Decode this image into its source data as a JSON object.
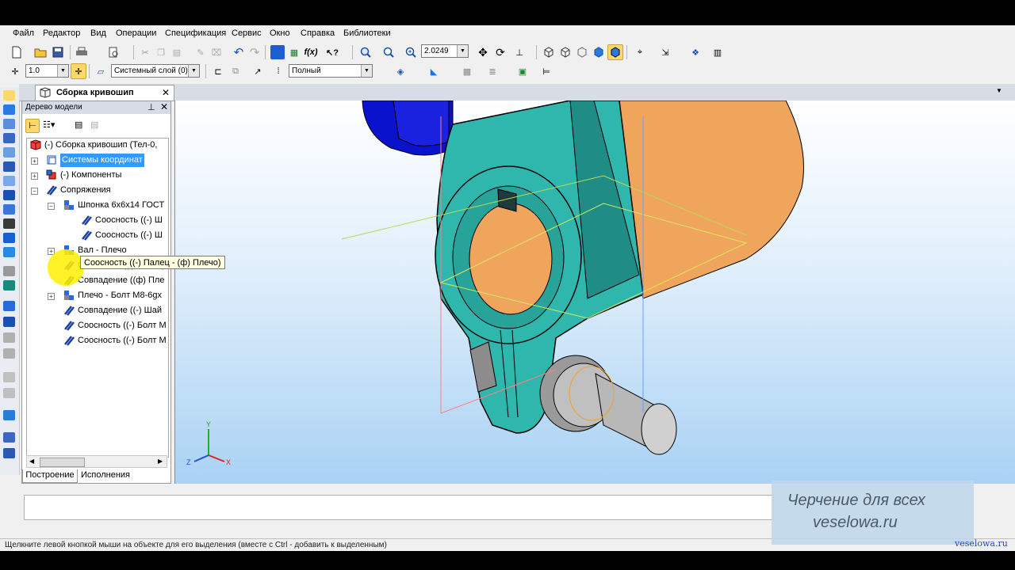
{
  "menu": [
    "Файл",
    "Редактор",
    "Вид",
    "Операции",
    "Спецификация",
    "Сервис",
    "Окно",
    "Справка",
    "Библиотеки"
  ],
  "toolbar1": {
    "zoom_value": "2.0249"
  },
  "toolbar2": {
    "step_value": "1.0",
    "layer_value": "Системный слой (0)",
    "mode_value": "Полный"
  },
  "document_tab": {
    "title": "Сборка кривошип"
  },
  "model_tree": {
    "header": "Дерево модели",
    "items": [
      "(-) Сборка кривошип (Тел-0,",
      "Системы координат",
      "(-) Компоненты",
      "Сопряжения",
      "Шпонка 6x6x14 ГОСТ",
      "Соосность ((-) Ш",
      "Соосность ((-) Ш",
      "Вал - Плечо",
      "Соосность ((-) Палец",
      "Совпадение ((ф) Пле",
      "Плечо - Болт М8-6gx",
      "Совпадение ((-) Шай",
      "Соосность ((-) Болт М",
      "Соосность ((-) Болт М"
    ],
    "tooltip": "Соосность ((-) Палец  - (ф) Плечо)",
    "tabs": [
      "Построение",
      "Исполнения"
    ]
  },
  "axes": {
    "x": "X",
    "y": "Y",
    "z": "Z"
  },
  "status_text": "Щелкните левой кнопкой мыши на объекте для его выделения (вместе с Ctrl - добавить к выделенным)",
  "watermark": {
    "line1": "Черчение для всех",
    "line2": "veselowa.ru",
    "corner": "veselowa.ru"
  },
  "colors": {
    "arm": "#2fb6ad",
    "shaft": "#f0a55c",
    "blue_part": "#0a12cc",
    "bolt": "#8c8c8c",
    "selection": "#3399ff",
    "tooltip_bg": "#ffffe1",
    "highlight": "#fff000"
  }
}
